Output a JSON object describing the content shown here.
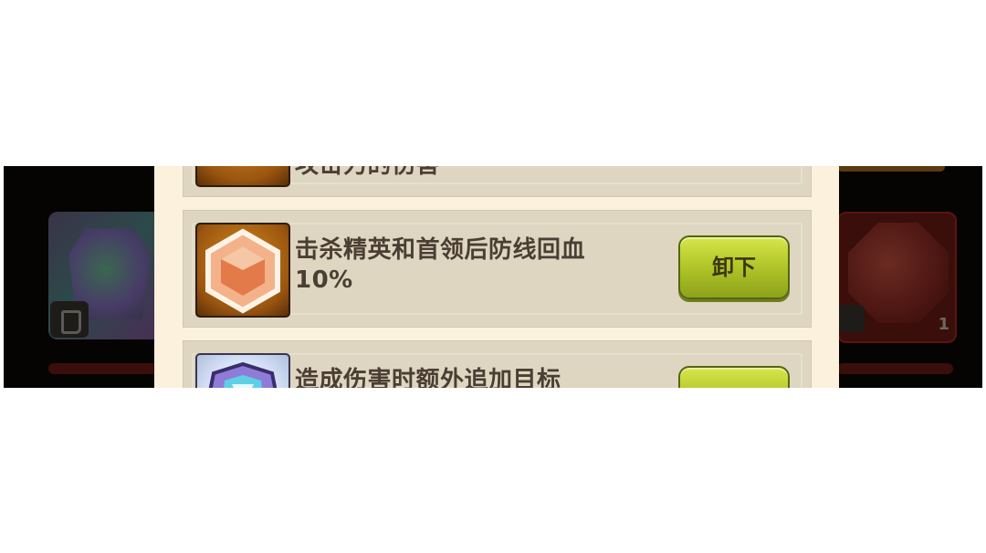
{
  "items": [
    {
      "description": "攻击力的伤害",
      "button_label": "",
      "icon": "orange-gem-icon"
    },
    {
      "description": "击杀精英和首领后防线回血10%",
      "button_label": "卸下",
      "icon": "orange-hexagon-gem-icon"
    },
    {
      "description": "造成伤害时额外追加目标",
      "button_label": "",
      "icon": "purple-crystal-gem-icon"
    }
  ],
  "background": {
    "right_slot_count": "1"
  },
  "colors": {
    "panel": "#fbf1dc",
    "row": "#ded6c1",
    "button": "#b3c82a",
    "text": "#4b3e33",
    "overlay": "#050403"
  }
}
